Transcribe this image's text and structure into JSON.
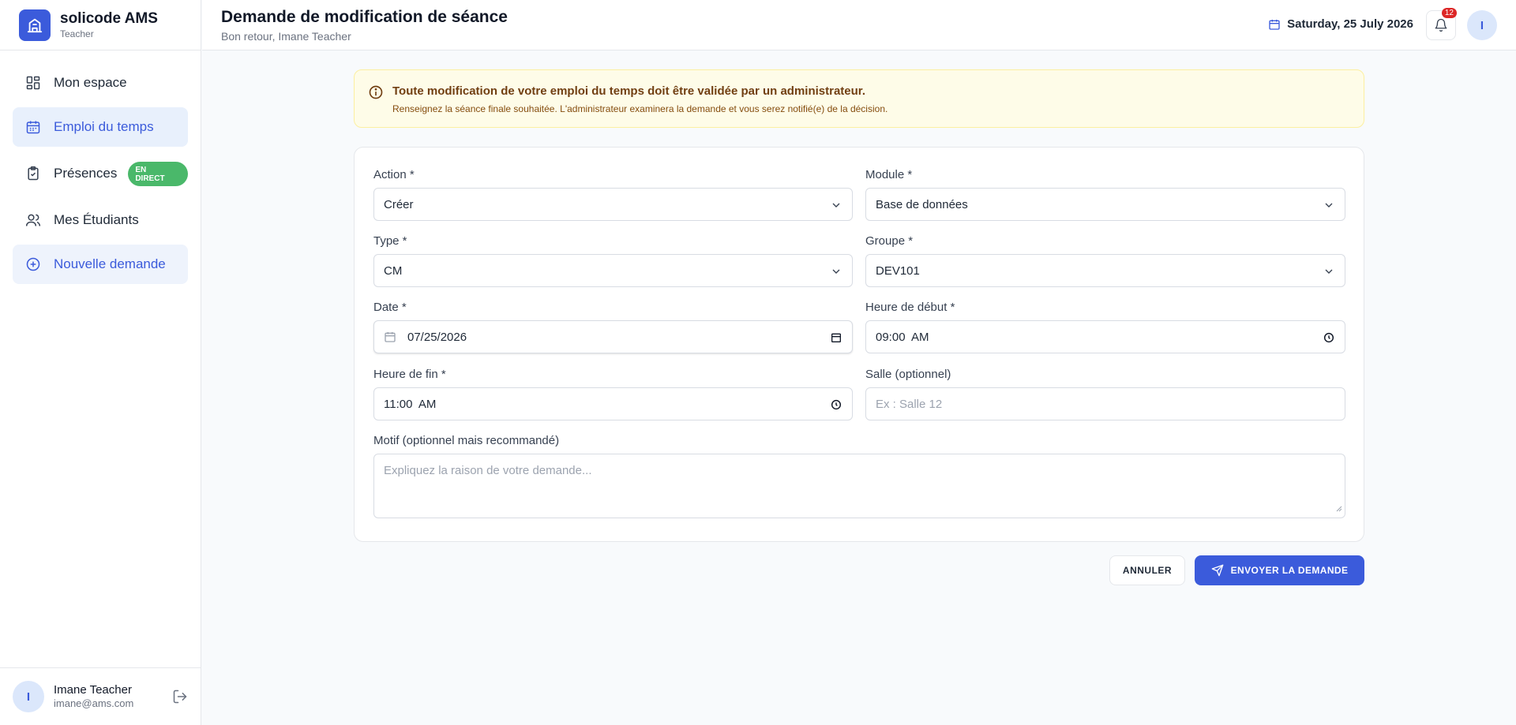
{
  "brand": {
    "name": "solicode AMS",
    "role": "Teacher"
  },
  "nav": [
    {
      "label": "Mon espace",
      "icon": "dashboard-grid-icon"
    },
    {
      "label": "Emploi du temps",
      "icon": "calendar-icon"
    },
    {
      "label": "Présences",
      "icon": "clipboard-check-icon",
      "badge": "EN DIRECT"
    },
    {
      "label": "Mes Étudiants",
      "icon": "users-icon"
    },
    {
      "label": "Nouvelle demande",
      "icon": "plus-circle-icon"
    }
  ],
  "user": {
    "initial": "I",
    "name": "Imane Teacher",
    "email": "imane@ams.com"
  },
  "header": {
    "title": "Demande de modification de séance",
    "subtitle": "Bon retour, Imane Teacher",
    "date": "Saturday, 25 July 2026",
    "notifications": "12",
    "avatar_initial": "I"
  },
  "alert": {
    "title": "Toute modification de votre emploi du temps doit être validée par un administrateur.",
    "text": "Renseignez la séance finale souhaitée. L'administrateur examinera la demande et vous serez notifié(e) de la décision."
  },
  "form": {
    "action": {
      "label": "Action *",
      "value": "Créer"
    },
    "module": {
      "label": "Module *",
      "value": "Base de données"
    },
    "type": {
      "label": "Type *",
      "value": "CM"
    },
    "groupe": {
      "label": "Groupe *",
      "value": "DEV101"
    },
    "date": {
      "label": "Date *",
      "value": "07/25/2026"
    },
    "heure_debut": {
      "label": "Heure de début *",
      "value": "09:00  AM"
    },
    "heure_fin": {
      "label": "Heure de fin *",
      "value": "11:00  AM"
    },
    "salle": {
      "label": "Salle (optionnel)",
      "placeholder": "Ex : Salle 12"
    },
    "motif": {
      "label": "Motif (optionnel mais recommandé)",
      "placeholder": "Expliquez la raison de votre demande..."
    }
  },
  "actions": {
    "cancel": "ANNULER",
    "send": "ENVOYER LA DEMANDE"
  },
  "colors": {
    "accent": "#3b5bdb",
    "live": "#4ab86a",
    "alert_bg": "#fefce8",
    "badge": "#dc2626"
  }
}
